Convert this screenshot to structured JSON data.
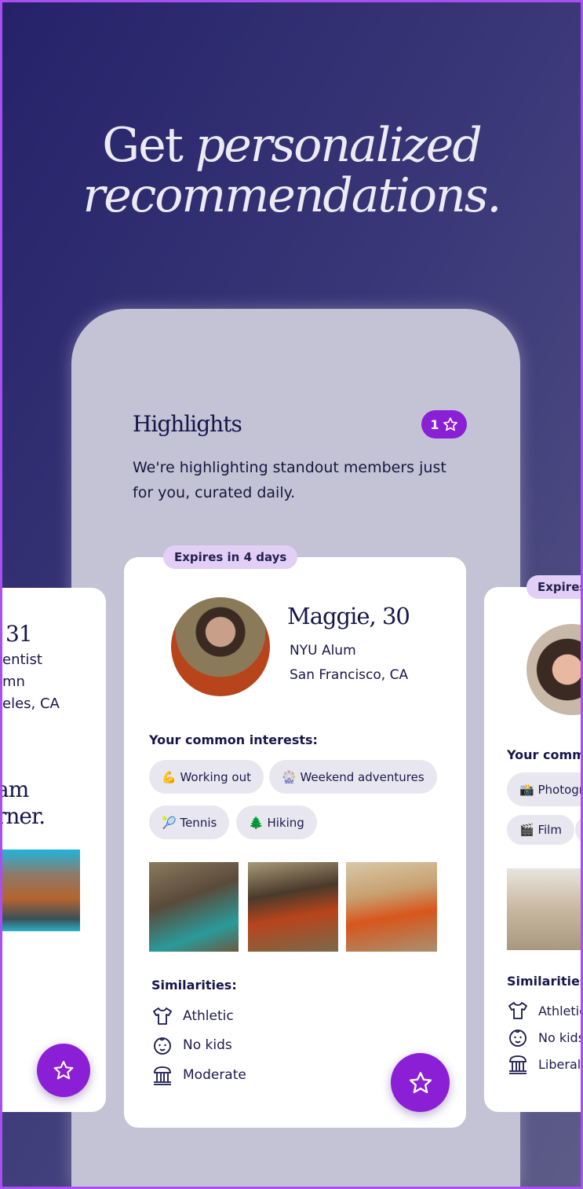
{
  "headline": {
    "line1_plain": "Get ",
    "line1_italic": "personalized",
    "line2_italic": "recommendations."
  },
  "highlights": {
    "title": "Highlights",
    "badge_count": "1",
    "description": "We're highlighting standout members just for you, curated daily."
  },
  "left_card": {
    "name_fragment": "31",
    "line1": "entist",
    "line2": "mn",
    "line3": "eles, CA",
    "quote_line1": "am",
    "quote_line2": "rner."
  },
  "main_card": {
    "expires": "Expires in 4 days",
    "name": "Maggie, 30",
    "school": "NYU Alum",
    "location": "San Francisco, CA",
    "interests_label": "Your common interests:",
    "interests": [
      {
        "emoji": "💪",
        "label": "Working out"
      },
      {
        "emoji": "🎡",
        "label": "Weekend adventures"
      },
      {
        "emoji": "🎾",
        "label": "Tennis"
      },
      {
        "emoji": "🌲",
        "label": "Hiking"
      }
    ],
    "similarities_label": "Similarities:",
    "similarities": [
      {
        "icon": "shirt-icon",
        "label": "Athletic"
      },
      {
        "icon": "baby-face-icon",
        "label": "No kids"
      },
      {
        "icon": "government-building-icon",
        "label": "Moderate"
      }
    ]
  },
  "right_card": {
    "expires": "Expires",
    "interests_label": "Your commo",
    "interests": [
      {
        "emoji": "📸",
        "label": "Photogra"
      },
      {
        "emoji": "🎬",
        "label": "Film"
      }
    ],
    "similarities_label": "Similarities:",
    "similarities": [
      {
        "icon": "shirt-icon",
        "label": "Athletic"
      },
      {
        "icon": "baby-face-icon",
        "label": "No kids"
      },
      {
        "icon": "government-building-icon",
        "label": "Liberal"
      }
    ]
  },
  "colors": {
    "accent": "#8a1fd6",
    "navy": "#17164a",
    "badge_bg": "#e2cff5"
  }
}
